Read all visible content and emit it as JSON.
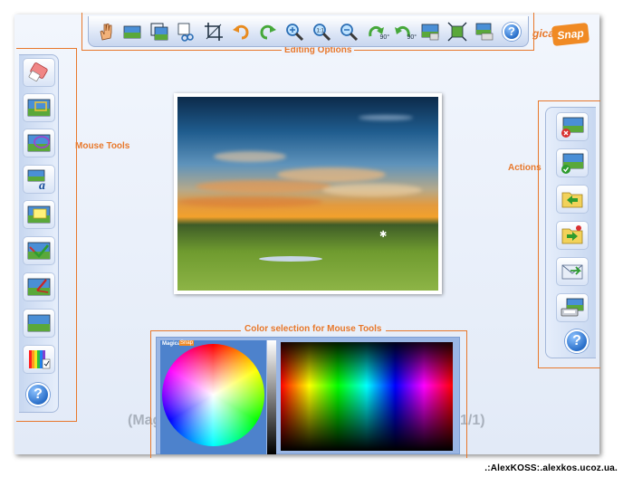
{
  "labels": {
    "editing_options": "Editing Options",
    "mouse_tools": "Mouse Tools",
    "actions": "Actions",
    "color_selection": "Color selection for Mouse Tools"
  },
  "logo": {
    "magical": "gical",
    "snap": "Snap",
    "mini_magical": "Magical",
    "mini_snap": "Snap"
  },
  "toolbar": {
    "buttons": [
      {
        "icon": "hand-icon"
      },
      {
        "icon": "image-icon"
      },
      {
        "icon": "resize-icon"
      },
      {
        "icon": "cut-icon"
      },
      {
        "icon": "crop-icon"
      },
      {
        "icon": "undo-icon"
      },
      {
        "icon": "redo-icon"
      },
      {
        "icon": "zoom-in-icon"
      },
      {
        "icon": "zoom-actual-icon"
      },
      {
        "icon": "zoom-out-icon"
      },
      {
        "icon": "rotate-right-icon",
        "label": "90°"
      },
      {
        "icon": "rotate-left-icon",
        "label": "90°"
      },
      {
        "icon": "image-settings-icon"
      },
      {
        "icon": "fit-icon"
      },
      {
        "icon": "screen-capture-icon"
      },
      {
        "icon": "help-icon",
        "label": "?"
      }
    ]
  },
  "mouse_tools": [
    {
      "icon": "eraser-icon"
    },
    {
      "icon": "selection-icon"
    },
    {
      "icon": "ellipse-icon"
    },
    {
      "icon": "text-icon",
      "label": "a"
    },
    {
      "icon": "note-icon"
    },
    {
      "icon": "check-mark-icon"
    },
    {
      "icon": "pen-icon"
    },
    {
      "icon": "landscape-icon"
    },
    {
      "icon": "color-palette-icon"
    },
    {
      "icon": "help-icon",
      "label": "?"
    }
  ],
  "actions": [
    {
      "icon": "delete-icon"
    },
    {
      "icon": "accept-icon"
    },
    {
      "icon": "open-folder-icon"
    },
    {
      "icon": "save-icon"
    },
    {
      "icon": "email-icon"
    },
    {
      "icon": "print-icon"
    },
    {
      "icon": "help-icon",
      "label": "?"
    }
  ],
  "counter": {
    "left": "(Mag",
    "right": "1/1)"
  },
  "colors": {
    "accent": "#e8782b",
    "panel_blue": "#9ab6e4",
    "button_blue": "#2a6fc9"
  },
  "watermark": ".:AlexKOSS:.alexkos.ucoz.ua."
}
